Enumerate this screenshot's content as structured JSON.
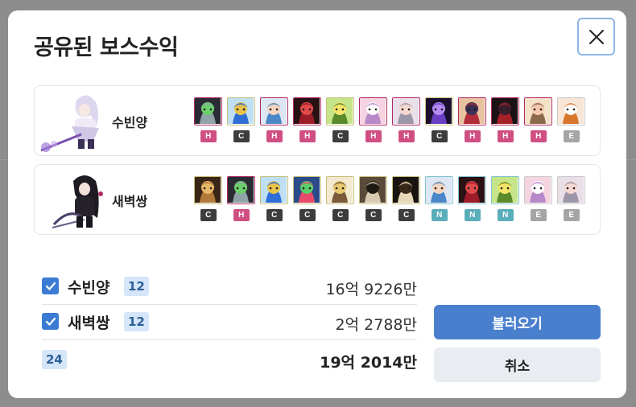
{
  "dialog": {
    "title": "공유된 보스수익",
    "close_icon": "close-icon"
  },
  "characters": [
    {
      "name": "수빈양",
      "bosses": [
        {
          "difficulty": "H",
          "palette": [
            "#2b2b33",
            "#8fa3a8",
            "#6bd06b"
          ]
        },
        {
          "difficulty": "C",
          "palette": [
            "#bfe0f4",
            "#2f6ed6",
            "#e8c24a"
          ]
        },
        {
          "difficulty": "H",
          "palette": [
            "#dce7f3",
            "#4a88c8",
            "#f5d5c0"
          ]
        },
        {
          "difficulty": "H",
          "palette": [
            "#2a1114",
            "#9c1c2a",
            "#e04a4a"
          ]
        },
        {
          "difficulty": "C",
          "palette": [
            "#c6e58a",
            "#5a8a2a",
            "#f4e56a"
          ]
        },
        {
          "difficulty": "H",
          "palette": [
            "#f5d3e1",
            "#b889c8",
            "#ffffff"
          ]
        },
        {
          "difficulty": "H",
          "palette": [
            "#e9dfe9",
            "#9c97a8",
            "#f7d8d0"
          ]
        },
        {
          "difficulty": "C",
          "palette": [
            "#1a0f2e",
            "#6a3fc4",
            "#b58cf2"
          ]
        },
        {
          "difficulty": "H",
          "palette": [
            "#e9c3a0",
            "#b12b3a",
            "#3a2f55"
          ]
        },
        {
          "difficulty": "H",
          "palette": [
            "#1a1214",
            "#a42128",
            "#3a1f2f"
          ]
        },
        {
          "difficulty": "H",
          "palette": [
            "#f5e3c9",
            "#8a6a4a",
            "#f7c9b0"
          ]
        },
        {
          "difficulty": "E",
          "palette": [
            "#f7e6d5",
            "#d8762c",
            "#fdfdfd"
          ]
        }
      ]
    },
    {
      "name": "새벽쌍",
      "bosses": [
        {
          "difficulty": "C",
          "palette": [
            "#3a2616",
            "#b27a3a",
            "#e8b86a"
          ]
        },
        {
          "difficulty": "H",
          "palette": [
            "#2b2b33",
            "#8fa3a8",
            "#6bd06b"
          ]
        },
        {
          "difficulty": "C",
          "palette": [
            "#bfe0f4",
            "#2f6ed6",
            "#e8c24a"
          ]
        },
        {
          "difficulty": "C",
          "palette": [
            "#2a4a8a",
            "#e84a6a",
            "#5ad06a"
          ]
        },
        {
          "difficulty": "C",
          "palette": [
            "#f2e9d0",
            "#7a5a3a",
            "#e8c870"
          ]
        },
        {
          "difficulty": "C",
          "palette": [
            "#5a4a3a",
            "#d8cab0",
            "#1f1a14"
          ]
        },
        {
          "difficulty": "C",
          "palette": [
            "#1a1410",
            "#e8d8b8",
            "#3a2a1a"
          ]
        },
        {
          "difficulty": "N",
          "palette": [
            "#dce7f3",
            "#4a88c8",
            "#f5d5c0"
          ]
        },
        {
          "difficulty": "N",
          "palette": [
            "#2a1114",
            "#9c1c2a",
            "#e04a4a"
          ]
        },
        {
          "difficulty": "N",
          "palette": [
            "#c6e58a",
            "#5a8a2a",
            "#f4e56a"
          ]
        },
        {
          "difficulty": "E",
          "palette": [
            "#f5d3e1",
            "#b889c8",
            "#ffffff"
          ]
        },
        {
          "difficulty": "E",
          "palette": [
            "#e9dfe9",
            "#9c97a8",
            "#f7d8d0"
          ]
        }
      ]
    }
  ],
  "summary": {
    "rows": [
      {
        "name": "수빈양",
        "count": "12",
        "amount": "16억 9226만",
        "checked": true
      },
      {
        "name": "새벽쌍",
        "count": "12",
        "amount": "2억 2788만",
        "checked": true
      }
    ],
    "total_count": "24",
    "total_amount": "19억 2014만"
  },
  "buttons": {
    "load_label": "불러오기",
    "cancel_label": "취소"
  },
  "colors": {
    "accent": "#4a7fce",
    "hard": "#d04f83",
    "chaos": "#3d3d3d",
    "normal": "#5aaeb9",
    "easy": "#a5a5a5"
  }
}
